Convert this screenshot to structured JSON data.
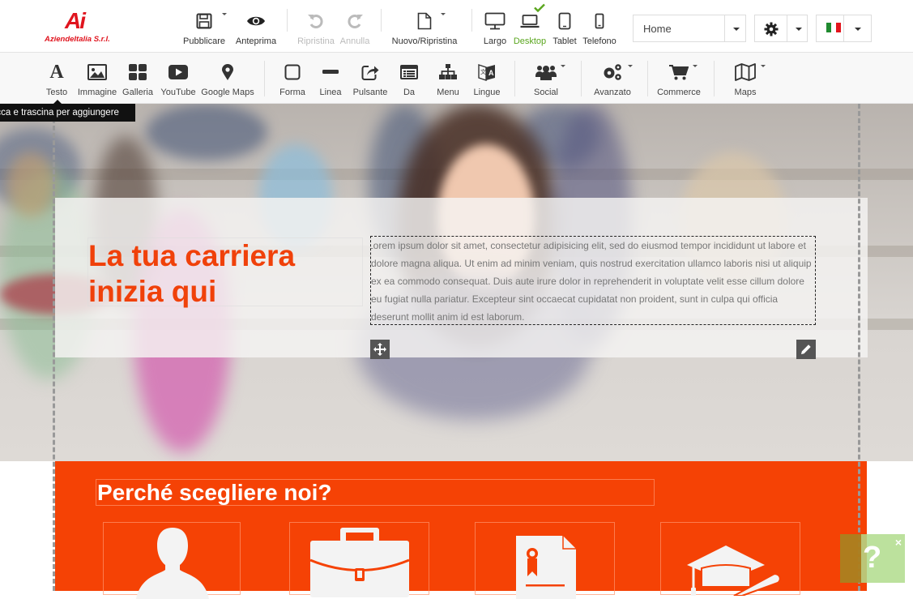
{
  "brand": {
    "logo_mark": "Ai",
    "logo_name": "AziendeItalia S.r.l."
  },
  "topbar": {
    "publish": "Pubblicare",
    "preview": "Anteprima",
    "undo": "Ripristina",
    "redo": "Annulla",
    "new_reset": "Nuovo/Ripristina",
    "devices": [
      {
        "label": "Largo",
        "active": false
      },
      {
        "label": "Desktop",
        "active": true
      },
      {
        "label": "Tablet",
        "active": false
      },
      {
        "label": "Telefono",
        "active": false
      }
    ],
    "page_select": "Home",
    "language_flag": "it"
  },
  "toolbar": {
    "items": [
      {
        "label": "Testo"
      },
      {
        "label": "Immagine"
      },
      {
        "label": "Galleria"
      },
      {
        "label": "YouTube"
      },
      {
        "label": "Google Maps"
      },
      {
        "label": "Forma"
      },
      {
        "label": "Linea"
      },
      {
        "label": "Pulsante"
      },
      {
        "label": "Da"
      },
      {
        "label": "Menu"
      },
      {
        "label": "Lingue"
      },
      {
        "label": "Social"
      },
      {
        "label": "Avanzato"
      },
      {
        "label": "Commerce"
      },
      {
        "label": "Maps"
      }
    ],
    "tooltip": "Clicca e trascina per aggiungere"
  },
  "hero": {
    "title": "La tua carriera inizia qui",
    "body": "Lorem ipsum dolor sit amet, consectetur adipisicing elit, sed do eiusmod tempor incididunt ut labore et dolore magna aliqua. Ut enim ad minim veniam, quis nostrud exercitation ullamco laboris nisi ut aliquip ex ea commodo consequat. Duis aute irure dolor in reprehenderit in voluptate velit esse cillum dolore eu fugiat nulla pariatur. Excepteur sint occaecat cupidatat non proident, sunt in culpa qui officia deserunt mollit anim id est laborum."
  },
  "features": {
    "title": "Perché scegliere noi?",
    "cards": [
      {
        "icon": "person-icon"
      },
      {
        "icon": "briefcase-icon"
      },
      {
        "icon": "certificate-icon"
      },
      {
        "icon": "graduation-cap-icon"
      }
    ]
  },
  "help": {
    "symbol": "?",
    "close": "×"
  },
  "colors": {
    "accent": "#f54205",
    "active_device": "#5aa61e",
    "help_bg": "#b0dc8c"
  }
}
